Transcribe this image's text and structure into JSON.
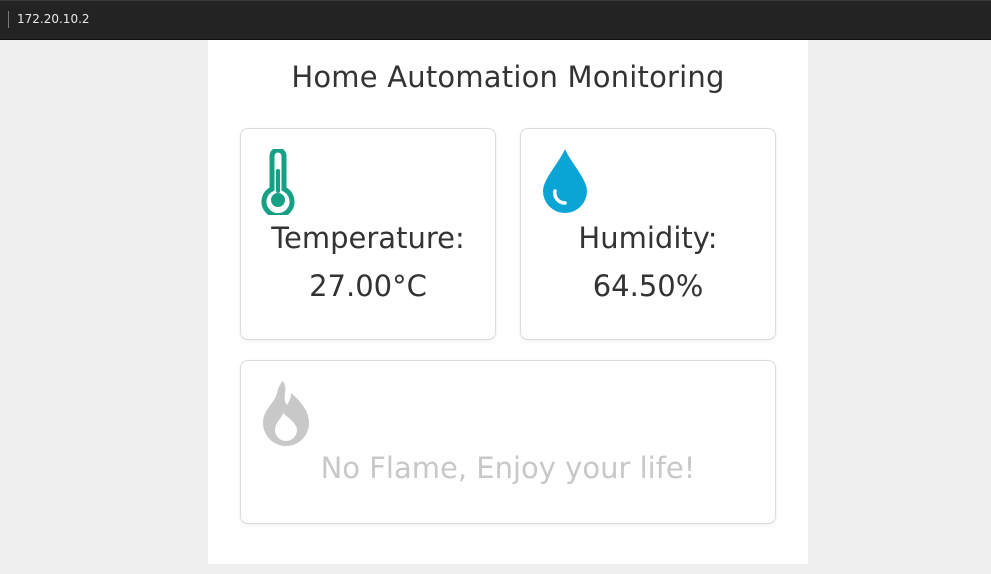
{
  "browser": {
    "address": "172.20.10.2"
  },
  "page": {
    "title": "Home Automation Monitoring"
  },
  "cards": {
    "temperature": {
      "icon": "thermometer-icon",
      "label": "Temperature:",
      "value": "27.00°C",
      "color": "#16a085"
    },
    "humidity": {
      "icon": "water-drop-icon",
      "label": "Humidity:",
      "value": "64.50%",
      "color": "#0aa5d4"
    },
    "flame": {
      "icon": "flame-icon",
      "status": "No Flame, Enjoy your life!",
      "color": "#c8c8c8"
    }
  }
}
